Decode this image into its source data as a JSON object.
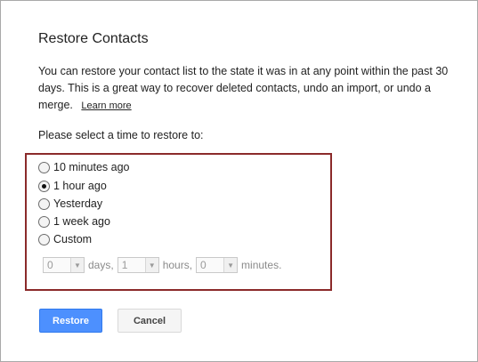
{
  "dialog": {
    "title": "Restore Contacts",
    "description": "You can restore your contact list to the state it was in at any point within the past 30 days. This is a great way to recover deleted contacts, undo an import, or undo a merge.",
    "learn_more": "Learn more",
    "prompt": "Please select a time to restore to:"
  },
  "options": [
    {
      "label": "10 minutes ago",
      "checked": false
    },
    {
      "label": "1 hour ago",
      "checked": true
    },
    {
      "label": "Yesterday",
      "checked": false
    },
    {
      "label": "1 week ago",
      "checked": false
    },
    {
      "label": "Custom",
      "checked": false
    }
  ],
  "custom": {
    "days_value": "0",
    "days_unit": "days,",
    "hours_value": "1",
    "hours_unit": "hours,",
    "minutes_value": "0",
    "minutes_unit": "minutes."
  },
  "buttons": {
    "restore": "Restore",
    "cancel": "Cancel"
  },
  "colors": {
    "primary_button": "#4d90fe",
    "highlight_border": "#8b2a2a"
  }
}
